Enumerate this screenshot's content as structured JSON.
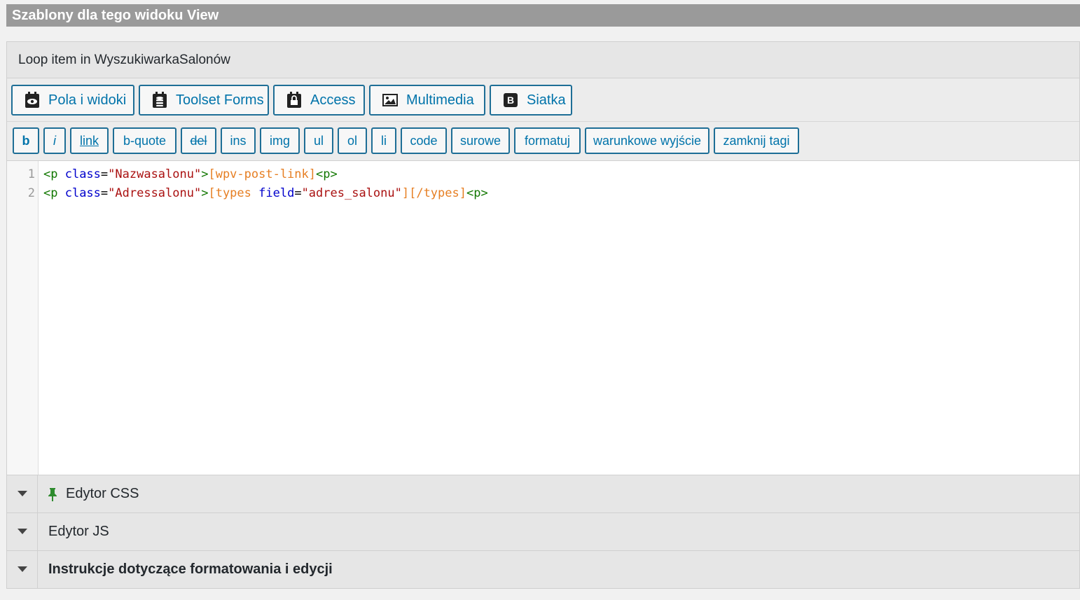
{
  "section_header": "Szablony dla tego widoku View",
  "panel": {
    "title": "Loop item in WyszukiwarkaSalonów"
  },
  "toolbar": {
    "buttons": [
      {
        "label": "Pola i widoki",
        "icon": "eye-icon"
      },
      {
        "label": "Toolset Forms",
        "icon": "database-icon"
      },
      {
        "label": "Access",
        "icon": "lock-icon"
      },
      {
        "label": "Multimedia",
        "icon": "image-icon"
      },
      {
        "label": "Siatka",
        "icon": "bootstrap-icon"
      }
    ],
    "icon_glyphs": {
      "bootstrap": "B"
    }
  },
  "quicktags": [
    "b",
    "i",
    "link",
    "b-quote",
    "del",
    "ins",
    "img",
    "ul",
    "ol",
    "li",
    "code",
    "surowe",
    "formatuj",
    "warunkowe wyjście",
    "zamknij tagi"
  ],
  "editor": {
    "line_numbers": [
      "1",
      "2"
    ],
    "lines": [
      [
        {
          "t": "<p ",
          "c": "tag"
        },
        {
          "t": "class",
          "c": "attr"
        },
        {
          "t": "=",
          "c": "plain"
        },
        {
          "t": "\"Nazwasalonu\"",
          "c": "str"
        },
        {
          "t": ">",
          "c": "tag"
        },
        {
          "t": "[wpv-post-link]",
          "c": "sc"
        },
        {
          "t": "<p>",
          "c": "tag"
        }
      ],
      [
        {
          "t": "<p ",
          "c": "tag"
        },
        {
          "t": "class",
          "c": "attr"
        },
        {
          "t": "=",
          "c": "plain"
        },
        {
          "t": "\"Adressalonu\"",
          "c": "str"
        },
        {
          "t": ">",
          "c": "tag"
        },
        {
          "t": "[types ",
          "c": "sc"
        },
        {
          "t": "field",
          "c": "attr"
        },
        {
          "t": "=",
          "c": "plain"
        },
        {
          "t": "\"adres_salonu\"",
          "c": "str"
        },
        {
          "t": "][/types]",
          "c": "sc"
        },
        {
          "t": "<p>",
          "c": "tag"
        }
      ]
    ]
  },
  "accordions": [
    {
      "label": "Edytor CSS",
      "pinned": true
    },
    {
      "label": "Edytor JS",
      "pinned": false
    },
    {
      "label": "Instrukcje dotyczące formatowania i edycji",
      "pinned": false
    }
  ],
  "colors": {
    "button_border": "#1e6e96",
    "button_text": "#0073aa",
    "tag": "#117700",
    "attr": "#0000cc",
    "string": "#aa1111",
    "shortcode": "#e67e22",
    "pin": "#2e8b2e"
  }
}
